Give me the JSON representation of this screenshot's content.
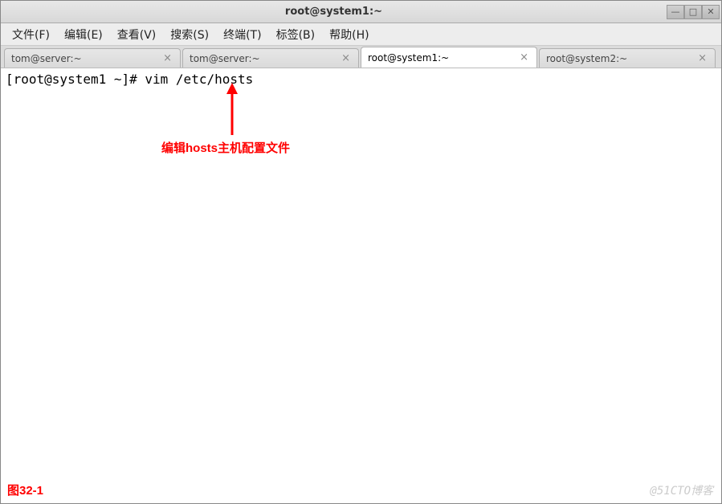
{
  "window": {
    "title": "root@system1:~",
    "controls": {
      "min": "—",
      "max": "□",
      "close": "✕"
    }
  },
  "menu": {
    "file": "文件(F)",
    "edit": "编辑(E)",
    "view": "查看(V)",
    "search": "搜索(S)",
    "terminal": "终端(T)",
    "tabs": "标签(B)",
    "help": "帮助(H)"
  },
  "tabs": [
    {
      "label": "tom@server:~",
      "active": false
    },
    {
      "label": "tom@server:~",
      "active": false
    },
    {
      "label": "root@system1:~",
      "active": true
    },
    {
      "label": "root@system2:~",
      "active": false
    }
  ],
  "tab_close_glyph": "×",
  "terminal": {
    "prompt_line": "[root@system1 ~]# vim /etc/hosts"
  },
  "annotation": {
    "text": "编辑hosts主机配置文件"
  },
  "figure_label": "图32-1",
  "watermark": "@51CTO博客"
}
